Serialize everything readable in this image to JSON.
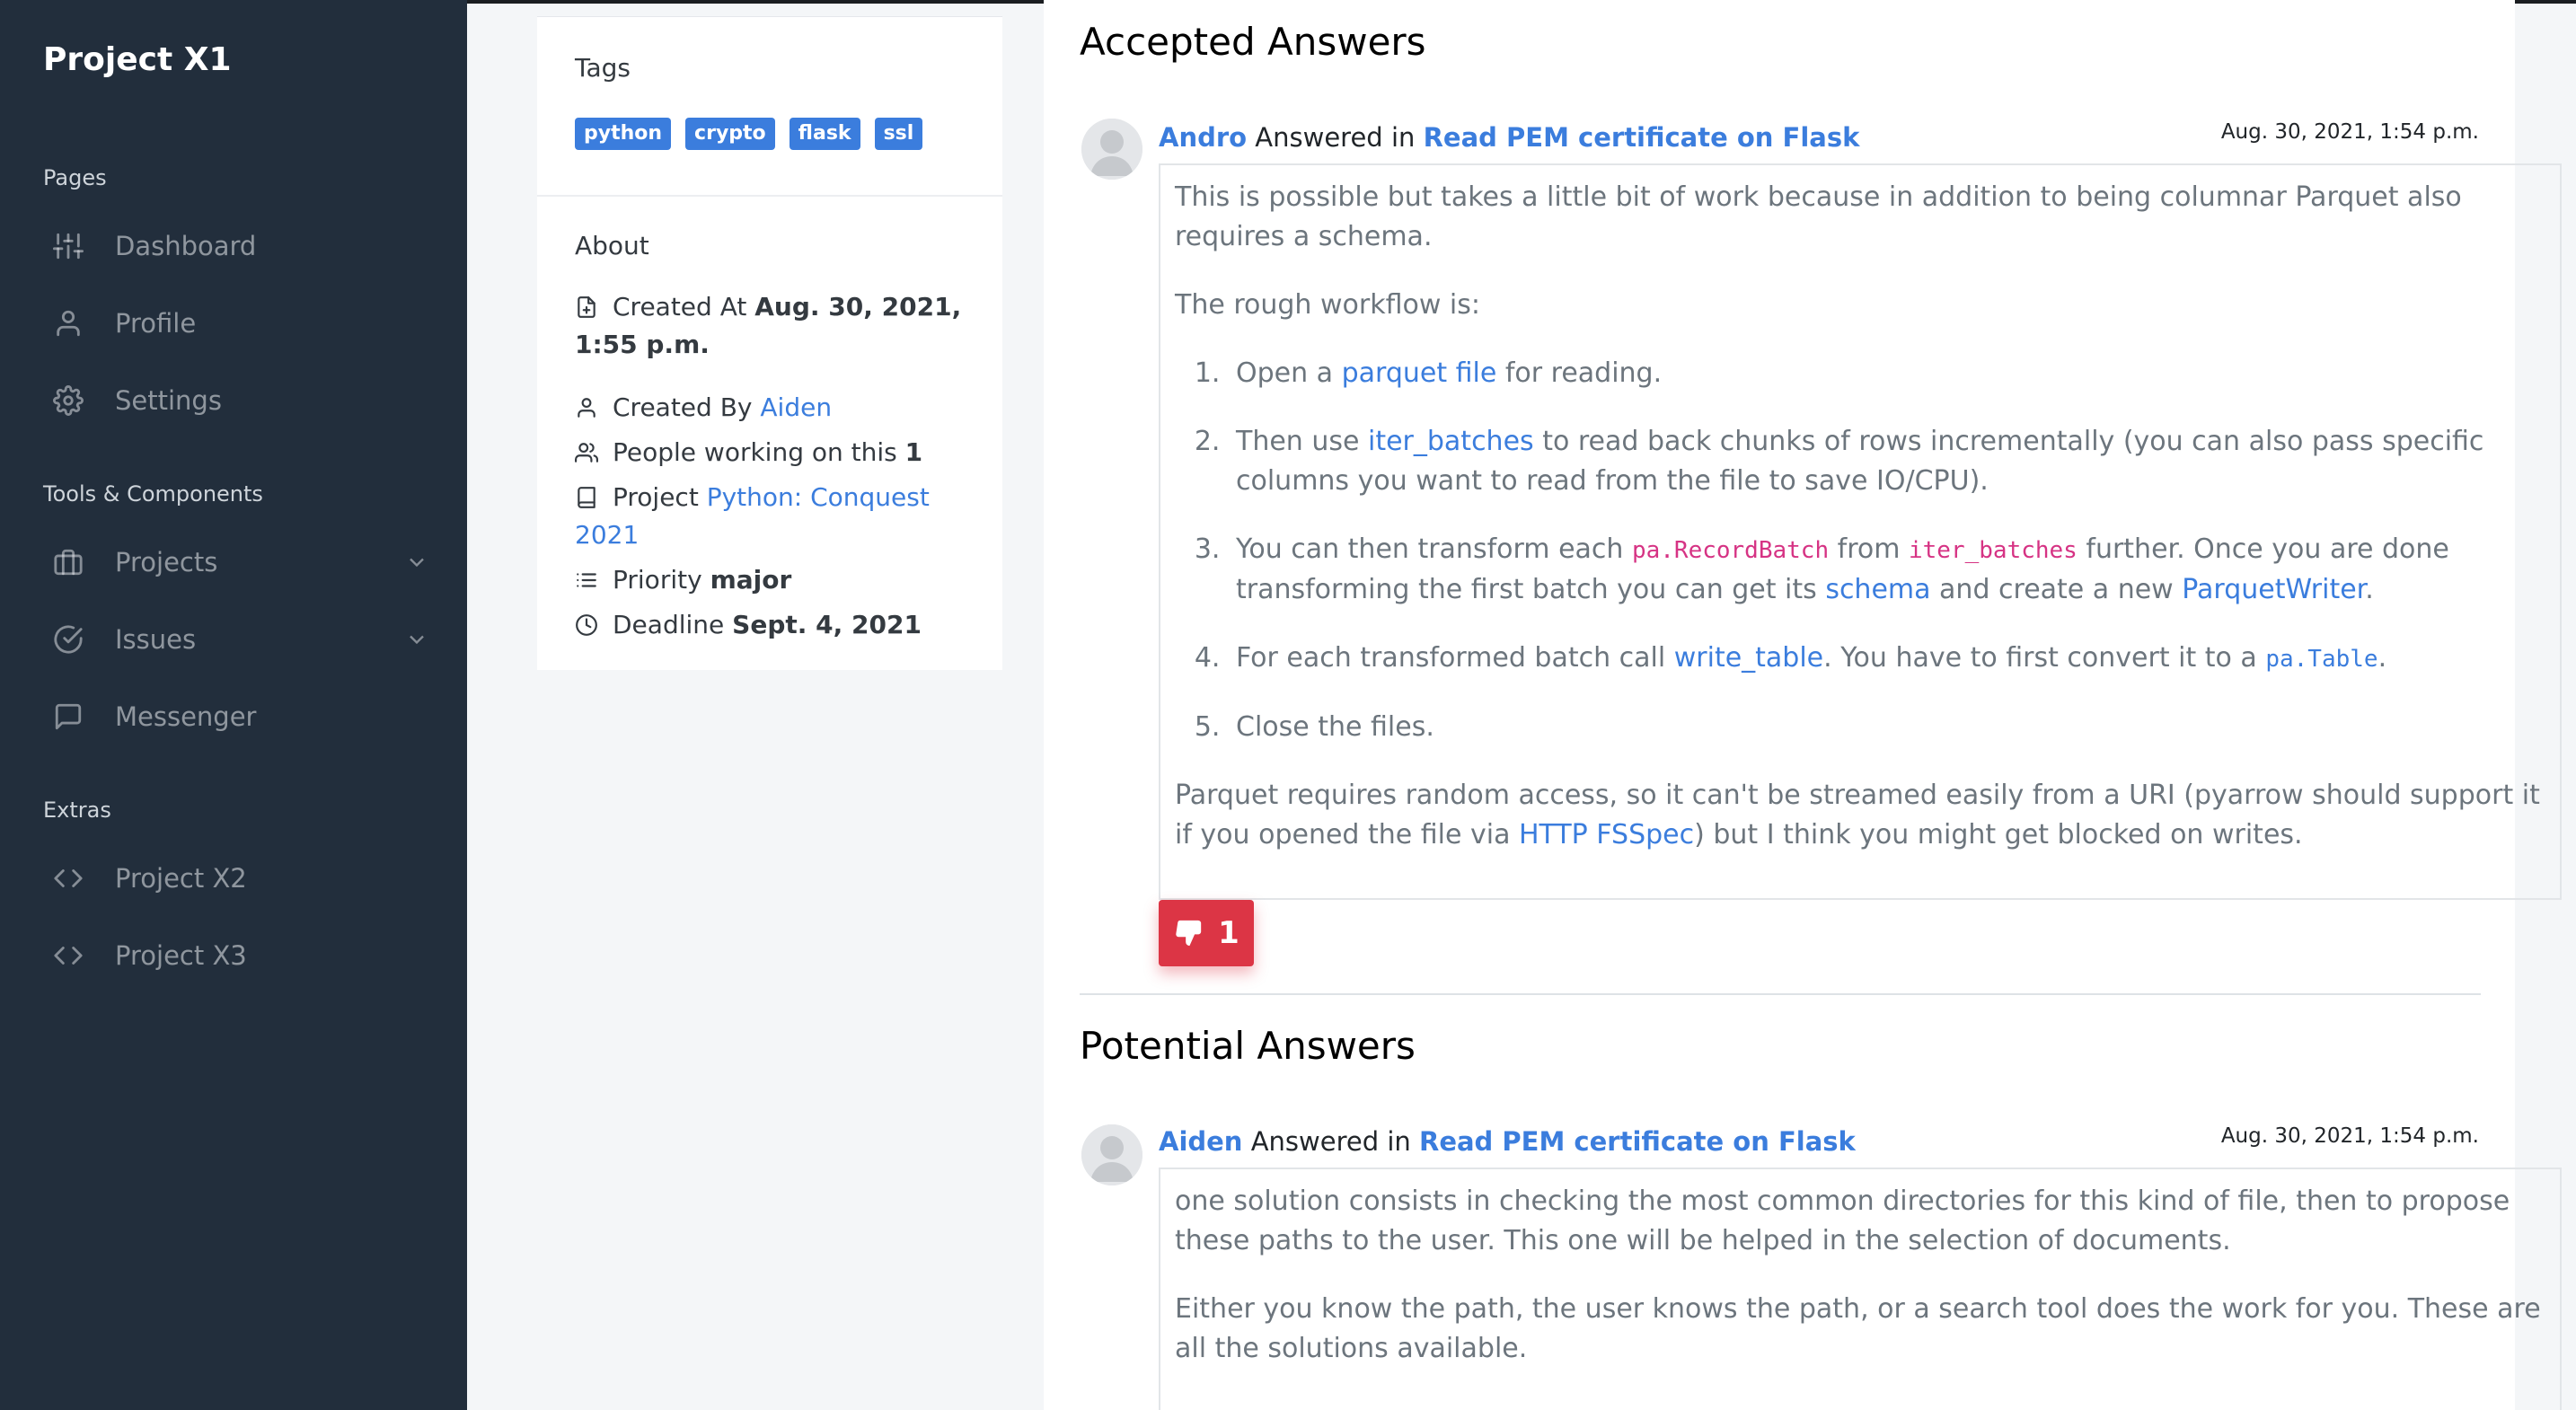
{
  "app": {
    "brand": "Project X1"
  },
  "sidebar": {
    "headers": {
      "pages": "Pages",
      "tools": "Tools & Components",
      "extras": "Extras"
    },
    "items": [
      {
        "label": "Dashboard",
        "icon": "sliders-icon"
      },
      {
        "label": "Profile",
        "icon": "user-icon"
      },
      {
        "label": "Settings",
        "icon": "gear-icon"
      },
      {
        "label": "Projects",
        "icon": "briefcase-icon",
        "expandable": true
      },
      {
        "label": "Issues",
        "icon": "check-circle-icon",
        "expandable": true
      },
      {
        "label": "Messenger",
        "icon": "message-square-icon"
      },
      {
        "label": "Project X2",
        "icon": "code-icon"
      },
      {
        "label": "Project X3",
        "icon": "code-icon"
      }
    ]
  },
  "details": {
    "tags_title": "Tags",
    "tags": [
      "python",
      "crypto",
      "flask",
      "ssl"
    ],
    "about_title": "About",
    "created_at_label": "Created At",
    "created_at_value": "Aug. 30, 2021, 1:55 p.m.",
    "created_by_label": "Created By",
    "created_by_value": "Aiden",
    "people_label": "People working on this",
    "people_value": "1",
    "project_label": "Project",
    "project_value": "Python: Conquest 2021",
    "priority_label": "Priority",
    "priority_value": "major",
    "deadline_label": "Deadline",
    "deadline_value": "Sept. 4, 2021"
  },
  "accepted": {
    "title": "Accepted Answers",
    "author": "Andro",
    "answered_in": "Answered in",
    "question": "Read PEM certificate on Flask",
    "date": "Aug. 30, 2021, 1:54 p.m.",
    "p1": "This is possible but takes a little bit of work because in addition to being columnar Parquet also requires a schema.",
    "p2": "The rough workflow is:",
    "li1_a": "Open a ",
    "li1_link": "parquet file",
    "li1_b": " for reading.",
    "li2_a": "Then use ",
    "li2_link": "iter_batches",
    "li2_b": " to read back chunks of rows incrementally (you can also pass specific columns you want to read from the file to save IO/CPU).",
    "li3_a": "You can then transform each ",
    "li3_code1": "pa.RecordBatch",
    "li3_b": " from ",
    "li3_code2": "iter_batches",
    "li3_c": " further. Once you are done transforming the first batch you can get its ",
    "li3_link1": "schema",
    "li3_d": " and create a new ",
    "li3_link2": "ParquetWriter",
    "li3_e": ".",
    "li4_a": "For each transformed batch call ",
    "li4_link": "write_table",
    "li4_b": ". You have to first convert it to a ",
    "li4_code": "pa.Table",
    "li4_c": ".",
    "li5": "Close the files.",
    "p3_a": "Parquet requires random access, so it can't be streamed easily from a URI (pyarrow should support it if you opened the file via ",
    "p3_link": "HTTP FSSpec",
    "p3_b": ") but I think you might get blocked on writes.",
    "votes": "1"
  },
  "potential": {
    "title": "Potential Answers",
    "author": "Aiden",
    "answered_in": "Answered in",
    "question": "Read PEM certificate on Flask",
    "date": "Aug. 30, 2021, 1:54 p.m.",
    "p1": "one solution consists in checking the most common directories for this kind of file, then to propose these paths to the user. This one will be helped in the selection of documents.",
    "p2": "Either you know the path, the user knows the path, or a search tool does the work for you. These are all the solutions available."
  },
  "colors": {
    "sidebar_bg": "#222e3c",
    "link": "#3b7ddd",
    "danger": "#dc3545"
  }
}
